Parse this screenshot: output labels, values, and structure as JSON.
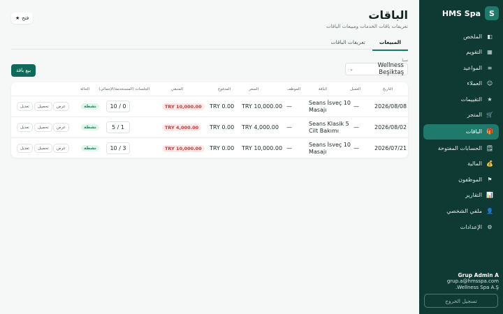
{
  "brand": {
    "badge": "S",
    "name": "HMS Spa"
  },
  "nav": [
    {
      "label": "الملخص",
      "icon": "◧"
    },
    {
      "label": "التقويم",
      "icon": "▦"
    },
    {
      "label": "المواعيد",
      "icon": "≡"
    },
    {
      "label": "العملاء",
      "icon": "☺"
    },
    {
      "label": "التقييمات",
      "icon": "★"
    },
    {
      "label": "المتجر",
      "icon": "🛒"
    },
    {
      "label": "الباقات",
      "icon": "🎁"
    },
    {
      "label": "الحسابات المفتوحة",
      "icon": "🗒"
    },
    {
      "label": "المالية",
      "icon": "💰"
    },
    {
      "label": "الموظفون",
      "icon": "⚑"
    },
    {
      "label": "التقارير",
      "icon": "📊"
    },
    {
      "label": "ملفي الشخصي",
      "icon": "👤"
    },
    {
      "label": "الإعدادات",
      "icon": "⚙"
    }
  ],
  "user": {
    "name": "Grup Admin A",
    "email": "grup.a@hmsspa.com",
    "company": "Wellness Spa A.Ş."
  },
  "logout_label": "تسجيل الخروج",
  "page": {
    "title": "الباقات",
    "subtitle": "تعريفات باقات الخدمات ومبيعات الباقات"
  },
  "open_button": {
    "icon": "★",
    "label": "فتح"
  },
  "tabs": [
    {
      "label": "المبيعات"
    },
    {
      "label": "تعريفات الباقات"
    }
  ],
  "branch": {
    "label": "سبا",
    "value": "Wellness Beşiktaş"
  },
  "sell_button": "بيع باقة",
  "table": {
    "headers": [
      "التاريخ",
      "العميل",
      "الباقة",
      "الموظف",
      "السعر",
      "المدفوع",
      "المتبقي",
      "الجلسات (المستخدمة/الإجمالي)",
      "الحالة"
    ],
    "rows": [
      {
        "date": "2026/08/08",
        "customer": "—",
        "package_l1": "Seans İsveç 10",
        "package_l2": "Masajı",
        "staff": "—",
        "price": "TRY 10,000.00",
        "paid": "TRY 0.00",
        "remaining": "TRY 10,000.00",
        "sessions": "10 / 0",
        "status": "نشطة"
      },
      {
        "date": "2026/08/02",
        "customer": "—",
        "package_l1": "Seans Klasik 5",
        "package_l2": "Cilt Bakımı",
        "staff": "—",
        "price": "TRY 4,000.00",
        "paid": "TRY 0.00",
        "remaining": "TRY 4,000.00",
        "sessions": "5 / 1",
        "status": "نشطة"
      },
      {
        "date": "2026/07/21",
        "customer": "—",
        "package_l1": "Seans İsveç 10",
        "package_l2": "Masajı",
        "staff": "—",
        "price": "TRY 10,000.00",
        "paid": "TRY 0.00",
        "remaining": "TRY 10,000.00",
        "sessions": "10 / 3",
        "status": "نشطة"
      }
    ],
    "actions": {
      "view": "عرض",
      "collect": "تحصيل",
      "edit": "تعديل"
    }
  },
  "colors": {
    "sidebar": "#0f3a33",
    "accent": "#1f7a6b",
    "danger": "#c23a3a",
    "success": "#1f8a5a"
  }
}
